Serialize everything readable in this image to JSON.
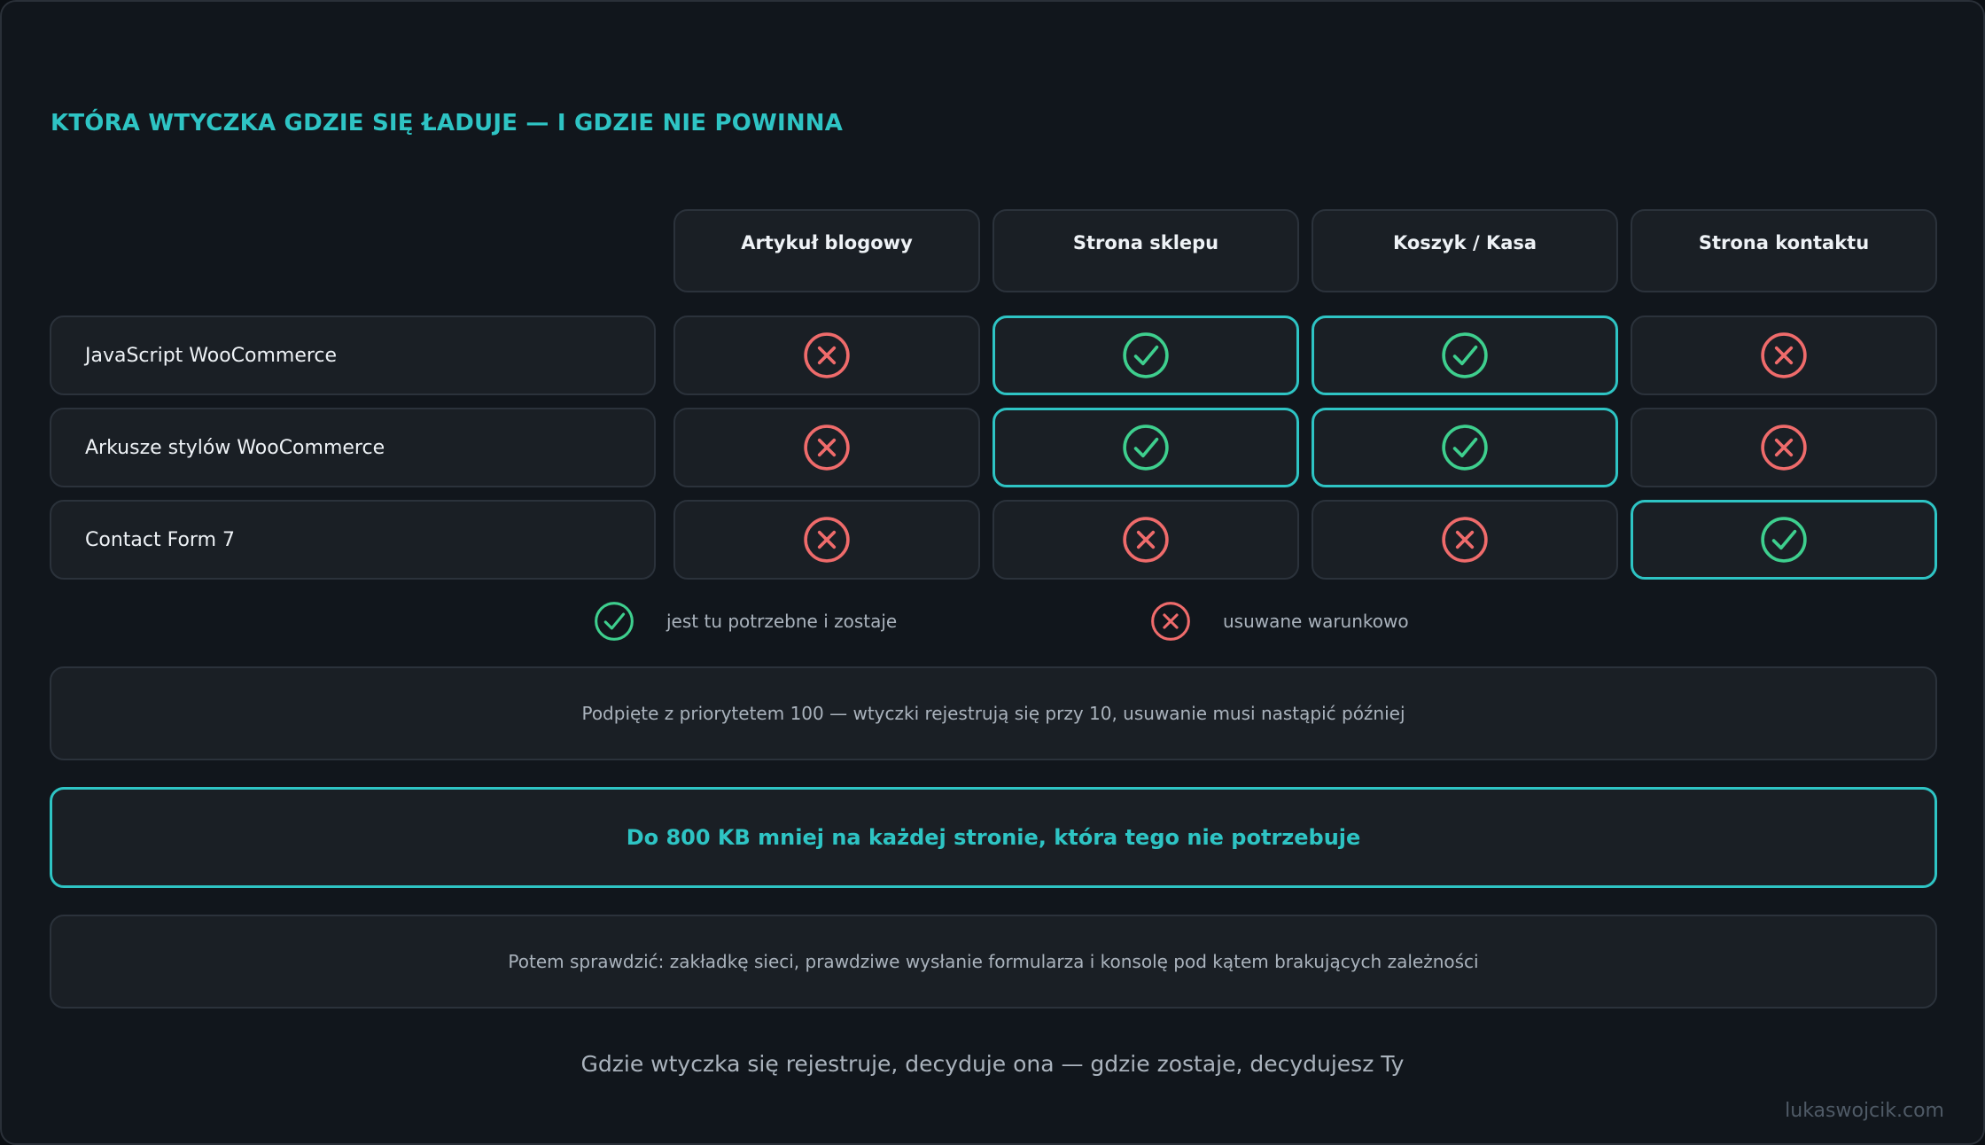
{
  "title": "KTÓRA WTYCZKA GDZIE SIĘ ŁADUJE — I GDZIE NIE POWINNA",
  "columns": [
    "Artykuł blogowy",
    "Strona sklepu",
    "Koszyk / Kasa",
    "Strona kontaktu"
  ],
  "rows": [
    {
      "label": "JavaScript WooCommerce",
      "loads": [
        false,
        true,
        true,
        false
      ]
    },
    {
      "label": "Arkusze stylów WooCommerce",
      "loads": [
        false,
        true,
        true,
        false
      ]
    },
    {
      "label": "Contact Form 7",
      "loads": [
        false,
        false,
        false,
        true
      ]
    }
  ],
  "legend": {
    "keep": "jest tu potrzebne i zostaje",
    "remove": "usuwane warunkowo"
  },
  "notes": {
    "priority": "Podpięte z priorytetem 100 — wtyczki rejestrują się przy 10, usuwanie musi nastąpić później",
    "savings": "Do 800 KB mniej na każdej stronie, która tego nie potrzebuje",
    "check": "Potem sprawdzić: zakładkę sieci, prawdziwe wysłanie formularza i konsolę pod kątem brakujących zależności"
  },
  "footer": "Gdzie wtyczka się rejestruje, decyduje ona — gdzie zostaje, decydujesz Ty",
  "credit": "lukaswojcik.com",
  "colors": {
    "accent": "#2ec4c4",
    "check": "#3ecf8e",
    "cross": "#ef6b6b"
  },
  "icons": {
    "keep": "check-circle-icon",
    "remove": "x-circle-icon"
  }
}
